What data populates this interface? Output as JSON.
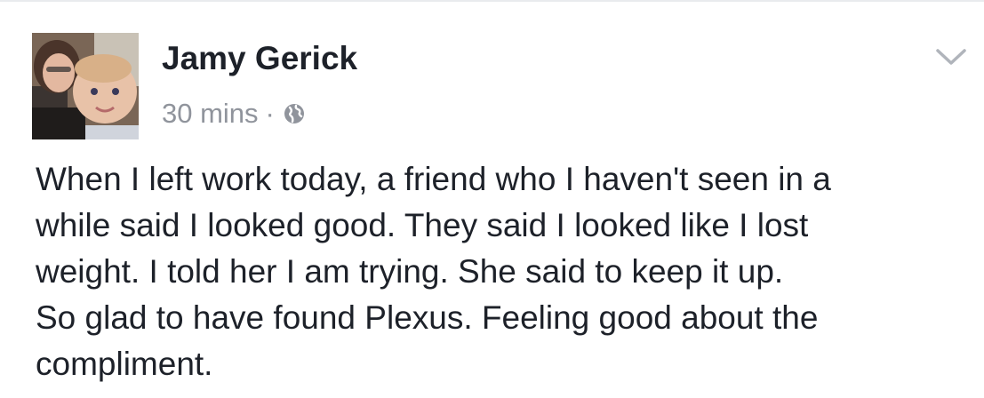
{
  "post": {
    "author": "Jamy Gerick",
    "timestamp": "30 mins",
    "separator": "·",
    "audience_icon": "globe-icon",
    "menu_icon": "chevron-down-icon",
    "text_lines": [
      "When I left work today, a friend who I haven't seen in a",
      "while said I looked good. They said I looked like I lost",
      "weight. I told her I am trying. She said to keep it up.",
      "So glad to have found Plexus. Feeling good about the",
      "compliment."
    ]
  },
  "colors": {
    "text": "#1d2129",
    "meta_text": "#90949c",
    "chevron": "#b0b4bb"
  }
}
